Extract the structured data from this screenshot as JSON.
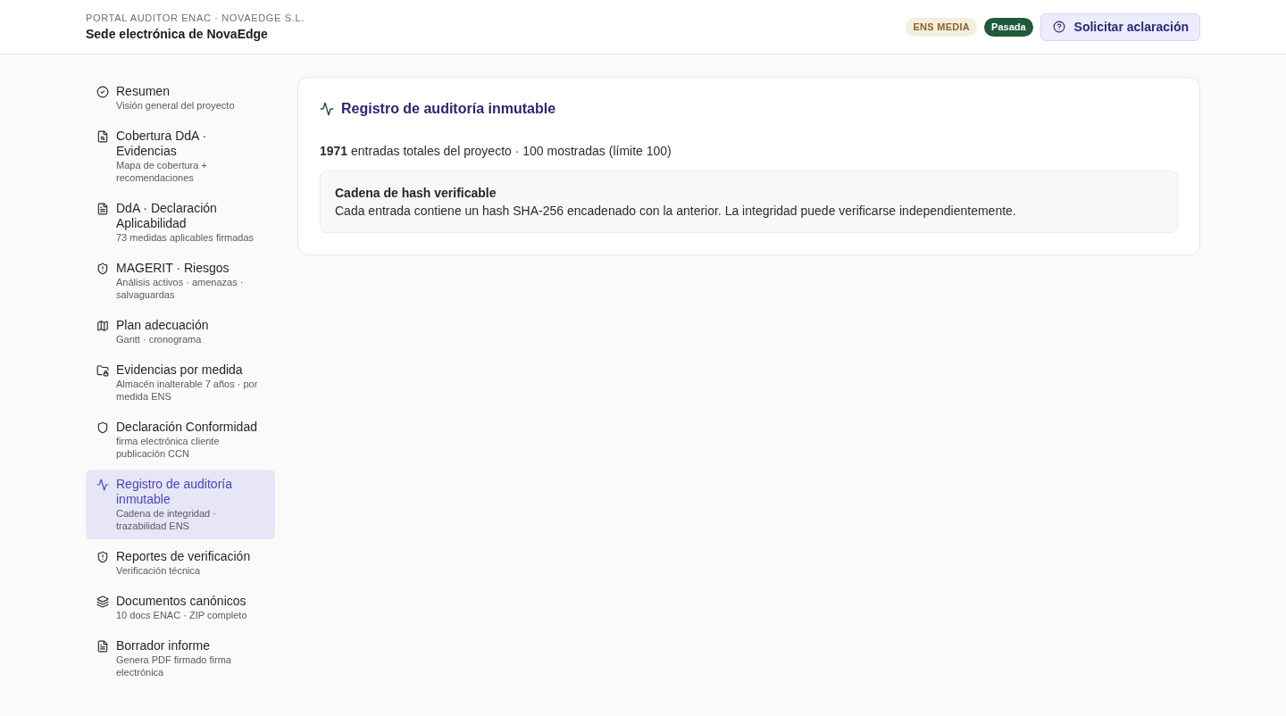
{
  "header": {
    "eyebrow": "PORTAL AUDITOR ENAC · NOVAEDGE S.L.",
    "title": "Sede electrónica de NovaEdge",
    "badges": [
      {
        "kind": "level",
        "label": "ENS MEDIA"
      },
      {
        "kind": "status",
        "label": "Pasada"
      }
    ],
    "action_button": {
      "label": "Solicitar aclaración"
    }
  },
  "sidebar": {
    "items": [
      {
        "title": "Resumen",
        "subtitle": "Visión general del proyecto",
        "selected": false
      },
      {
        "title": "Cobertura DdA · Evidencias",
        "subtitle": "Mapa de cobertura + recomendaciones",
        "selected": false
      },
      {
        "title": "DdA · Declaración Aplicabilidad",
        "subtitle": "73 medidas aplicables firmadas",
        "selected": false
      },
      {
        "title": "MAGERIT · Riesgos",
        "subtitle": "Análisis activos · amenazas · salvaguardas",
        "selected": false
      },
      {
        "title": "Plan adecuación",
        "subtitle": "Gantt · cronograma",
        "selected": false
      },
      {
        "title": "Evidencias por medida",
        "subtitle": "Almacén inalterable 7 años · por medida ENS",
        "selected": false
      },
      {
        "title": "Declaración Conformidad",
        "subtitle": "firma electrónica cliente publicación CCN",
        "selected": false
      },
      {
        "title": "Registro de auditoría inmutable",
        "subtitle": "Cadena de integridad · trazabilidad ENS",
        "selected": true
      },
      {
        "title": "Reportes de verificación",
        "subtitle": "Verificación técnica",
        "selected": false
      },
      {
        "title": "Documentos canónicos",
        "subtitle": "10 docs ENAC · ZIP completo",
        "selected": false
      },
      {
        "title": "Borrador informe",
        "subtitle": "Genera PDF firmado firma electrónica",
        "selected": false
      }
    ]
  },
  "panel": {
    "title": "Registro de auditoría inmutable",
    "summary": "**1971** entradas totales del proyecto · 100 mostradas (límite 100)",
    "notice": {
      "title": "Cadena de hash verificable",
      "text": "Cada entrada contiene un hash SHA-256 encadenado con la anterior. La integridad puede verificarse independientemente."
    }
  }
}
